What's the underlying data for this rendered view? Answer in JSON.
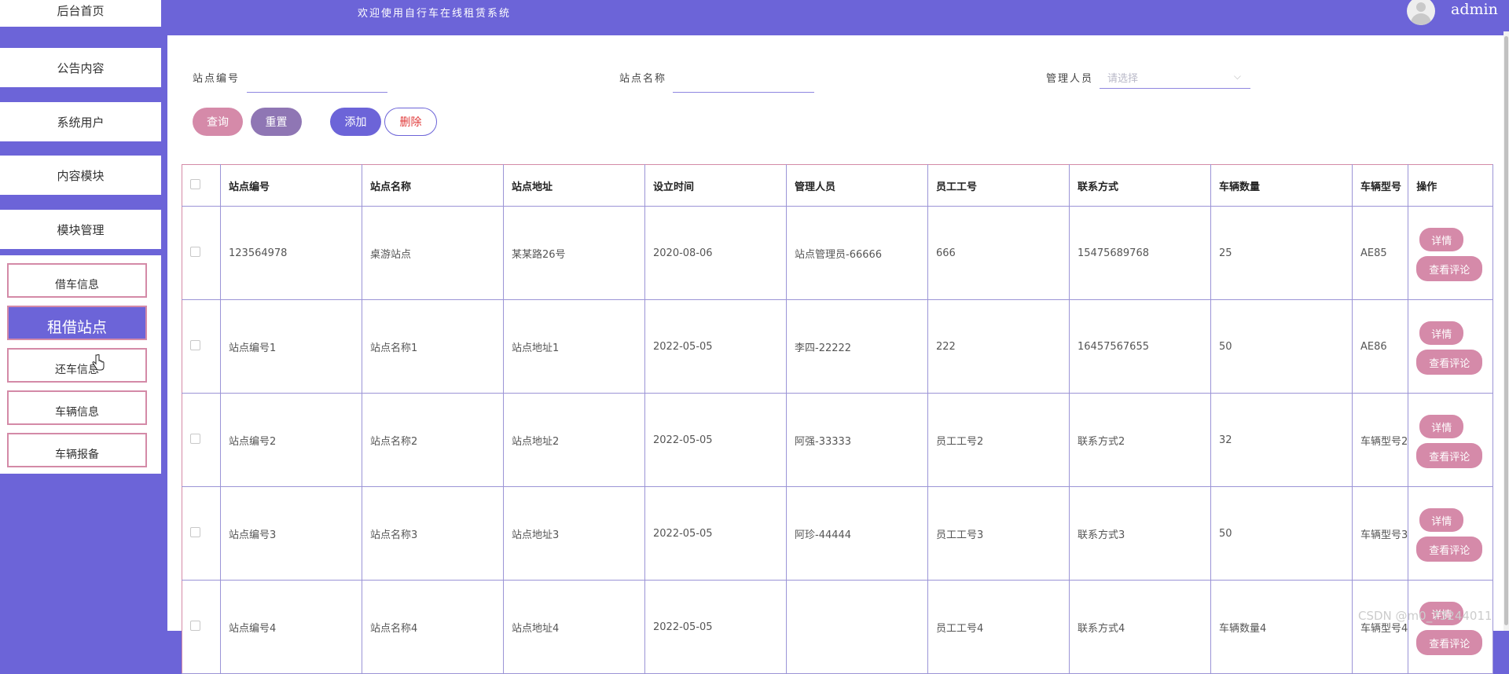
{
  "header": {
    "welcome": "欢迎使用自行车在线租赁系统",
    "username": "admin"
  },
  "sidebar": {
    "menu": [
      "后台首页",
      "公告内容",
      "系统用户",
      "内容模块",
      "模块管理"
    ],
    "submenu": [
      "借车信息",
      "租借站点",
      "还车信息",
      "车辆信息",
      "车辆报备"
    ],
    "active": "租借站点"
  },
  "filters": {
    "station_code_label": "站点编号",
    "station_name_label": "站点名称",
    "manager_label": "管理人员",
    "manager_placeholder": "请选择"
  },
  "actions": {
    "query": "查询",
    "reset": "重置",
    "add": "添加",
    "delete": "删除"
  },
  "table": {
    "columns": [
      "站点编号",
      "站点名称",
      "站点地址",
      "设立时间",
      "管理人员",
      "员工工号",
      "联系方式",
      "车辆数量",
      "车辆型号",
      "操作"
    ],
    "rows": [
      [
        "123564978",
        "桌游站点",
        "某某路26号",
        "2020-08-06",
        "站点管理员-66666",
        "666",
        "15475689768",
        "25",
        "AE85"
      ],
      [
        "站点编号1",
        "站点名称1",
        "站点地址1",
        "2022-05-05",
        "李四-22222",
        "222",
        "16457567655",
        "50",
        "AE86"
      ],
      [
        "站点编号2",
        "站点名称2",
        "站点地址2",
        "2022-05-05",
        "阿强-33333",
        "员工工号2",
        "联系方式2",
        "32",
        "车辆型号2"
      ],
      [
        "站点编号3",
        "站点名称3",
        "站点地址3",
        "2022-05-05",
        "阿珍-44444",
        "员工工号3",
        "联系方式3",
        "50",
        "车辆型号3"
      ],
      [
        "站点编号4",
        "站点名称4",
        "站点地址4",
        "2022-05-05",
        "",
        "员工工号4",
        "联系方式4",
        "车辆数量4",
        "车辆型号4"
      ]
    ],
    "detail_label": "详情",
    "comment_label": "查看评论"
  },
  "watermark": "CSDN @m0_73244011",
  "colors": {
    "primary": "#6c64d8",
    "pink": "#d58aa9",
    "mauve": "#8f76b4",
    "danger": "#e03b3b"
  }
}
